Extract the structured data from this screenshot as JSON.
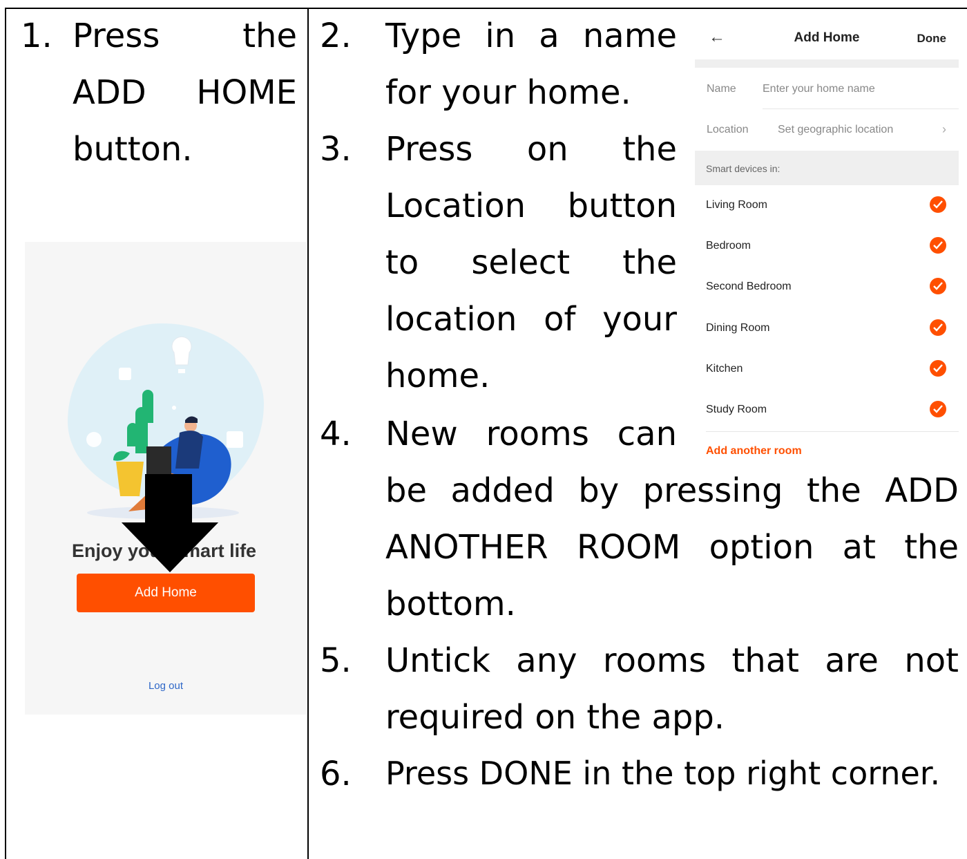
{
  "step1": {
    "number": "1.",
    "line1_word1": "Press",
    "line1_word2": "the",
    "line2_word1": "ADD",
    "line2_word2": "HOME",
    "line3": "button."
  },
  "steps_right": {
    "s2_number": "2.",
    "s2_line1_words": [
      "Type",
      "in",
      "a",
      "name"
    ],
    "s2_line2": "for your home.",
    "s3_number": "3.",
    "s3_line1_words": [
      "Press",
      "on",
      "the"
    ],
    "s3_line2_words": [
      "Location",
      "button"
    ],
    "s3_line3_words": [
      "to",
      "select",
      "the"
    ],
    "s3_line4_words": [
      "location",
      "of",
      "your"
    ],
    "s3_line5": "home.",
    "s4_number": "4.",
    "s4_line1_words": [
      "New",
      "rooms",
      "can"
    ],
    "s4_line2_words": [
      "be",
      "added",
      "by",
      "pressing",
      "the",
      "ADD"
    ],
    "s4_line3_words": [
      "ANOTHER",
      "ROOM",
      "option",
      "at",
      "the"
    ],
    "s4_line4": "bottom.",
    "s5_number": "5.",
    "s5_line1_words": [
      "Untick",
      "any",
      "rooms",
      "that",
      "are",
      "not"
    ],
    "s5_line2": "required on the app.",
    "s6_number": "6.",
    "s6_line1": "Press DONE in the top right corner."
  },
  "phone1": {
    "tagline": "Enjoy your smart life",
    "add_home_button": "Add Home",
    "logout": "Log out",
    "colors": {
      "accent": "#ff4f00",
      "link": "#2d66c7",
      "bg": "#f6f6f6"
    }
  },
  "phone2": {
    "title": "Add Home",
    "done": "Done",
    "back_icon": "arrow-left-icon",
    "name_label": "Name",
    "name_placeholder": "Enter your home name",
    "location_label": "Location",
    "location_value": "Set geographic location",
    "section_label": "Smart devices in:",
    "rooms": [
      {
        "label": "Living Room",
        "checked": true
      },
      {
        "label": "Bedroom",
        "checked": true
      },
      {
        "label": "Second Bedroom",
        "checked": true
      },
      {
        "label": "Dining Room",
        "checked": true
      },
      {
        "label": "Kitchen",
        "checked": true
      },
      {
        "label": "Study Room",
        "checked": true
      }
    ],
    "add_room": "Add another room"
  }
}
